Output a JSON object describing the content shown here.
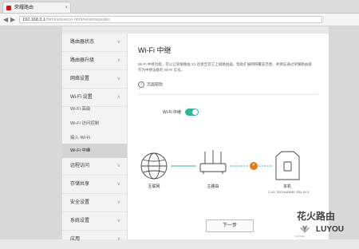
{
  "browser": {
    "tab_title": "荣耀路由",
    "tab_close": "×",
    "back": "◀",
    "forward": "▶",
    "url_host": "192.168.3.1",
    "url_path": "/html/advance.html#wlanrepeater"
  },
  "sidebar": {
    "items": [
      {
        "label": "路由器状态",
        "chev": "∨"
      },
      {
        "label": "路由器升级",
        "chev": "∨"
      },
      {
        "label": "网络设置",
        "chev": "∨"
      },
      {
        "label": "Wi-Fi 设置",
        "chev": "∧"
      },
      {
        "label": "远程访问",
        "chev": "∨"
      },
      {
        "label": "存储共享",
        "chev": "∨"
      },
      {
        "label": "安全设置",
        "chev": "∨"
      },
      {
        "label": "系统设置",
        "chev": "∨"
      },
      {
        "label": "应用",
        "chev": "∨"
      }
    ],
    "subitems": [
      {
        "label": "Wi-Fi 高级"
      },
      {
        "label": "Wi-Fi 访问控制"
      },
      {
        "label": "接入 Wi-Fi"
      },
      {
        "label": "Wi-Fi 中继"
      }
    ]
  },
  "panel": {
    "title": "Wi-Fi 中继",
    "description": "Wi-Fi 中继功能，可以让荣耀路由 X1 连接至其它上级路由器，帮助扩展网络覆盖范围，并保证通过荣耀路由器作为中继设备的 Wi-Fi 信号。",
    "help_icon": "?",
    "help_label": "页面帮助",
    "wifi_relay_label": "Wi-Fi 中继",
    "wifi_relay_on": true,
    "nodes": {
      "internet": "互联网",
      "upstream": "主路由",
      "local": "本机",
      "local_sub": "2.4G: 50CHANNEL.RELAY.X"
    },
    "link_status": "✕",
    "next_button": "下一步"
  },
  "colors": {
    "accent": "#2fb59b",
    "link": "#2fb59b",
    "error": "#e47a19"
  },
  "watermark": {
    "line1": "花火路由",
    "line2": "LUYOU",
    "brand": "HUAWEI"
  }
}
